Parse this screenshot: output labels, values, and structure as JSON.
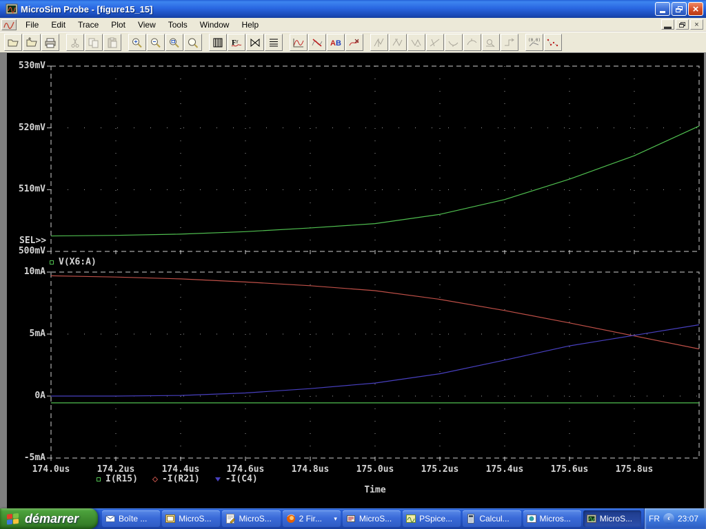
{
  "window": {
    "title": "MicroSim Probe - [figure15_15]",
    "menu": [
      "File",
      "Edit",
      "Trace",
      "Plot",
      "View",
      "Tools",
      "Window",
      "Help"
    ]
  },
  "toolbar": {
    "buttons": [
      {
        "name": "open",
        "icon": "open-icon",
        "enabled": true,
        "group": 1
      },
      {
        "name": "open-append",
        "icon": "open-append-icon",
        "enabled": true,
        "group": 1
      },
      {
        "name": "print",
        "icon": "print-icon",
        "enabled": true,
        "group": 1
      },
      {
        "name": "cut",
        "icon": "cut-icon",
        "enabled": false,
        "group": 2
      },
      {
        "name": "copy",
        "icon": "copy-icon",
        "enabled": false,
        "group": 2
      },
      {
        "name": "paste",
        "icon": "paste-icon",
        "enabled": false,
        "group": 2
      },
      {
        "name": "zoom-in",
        "icon": "zoom-in-icon",
        "enabled": true,
        "group": 3
      },
      {
        "name": "zoom-out",
        "icon": "zoom-out-icon",
        "enabled": true,
        "group": 3
      },
      {
        "name": "zoom-area",
        "icon": "zoom-area-icon",
        "enabled": true,
        "group": 3
      },
      {
        "name": "zoom-fit",
        "icon": "zoom-fit-icon",
        "enabled": true,
        "group": 3
      },
      {
        "name": "plot-columns",
        "icon": "plot-columns-icon",
        "enabled": true,
        "group": 4
      },
      {
        "name": "fourier",
        "icon": "fourier-icon",
        "enabled": true,
        "group": 4
      },
      {
        "name": "x-axis-settings",
        "icon": "x-axis-icon",
        "enabled": true,
        "group": 4
      },
      {
        "name": "y-axis-settings",
        "icon": "y-axis-icon",
        "enabled": true,
        "group": 4
      },
      {
        "name": "add-trace",
        "icon": "add-trace-icon",
        "enabled": true,
        "group": 5
      },
      {
        "name": "delete-trace",
        "icon": "delete-trace-icon",
        "enabled": true,
        "group": 5
      },
      {
        "name": "eval-goal-function",
        "icon": "eval-goal-icon",
        "enabled": true,
        "group": 5
      },
      {
        "name": "mark-trace",
        "icon": "mark-trace-icon",
        "enabled": true,
        "group": 5
      },
      {
        "name": "cursor-toggle",
        "icon": "cursor-toggle-icon",
        "enabled": false,
        "group": 6
      },
      {
        "name": "cursor-peak",
        "icon": "cursor-peak-icon",
        "enabled": false,
        "group": 6
      },
      {
        "name": "cursor-trough",
        "icon": "cursor-trough-icon",
        "enabled": false,
        "group": 6
      },
      {
        "name": "cursor-slope",
        "icon": "cursor-slope-icon",
        "enabled": false,
        "group": 6
      },
      {
        "name": "cursor-min",
        "icon": "cursor-min-icon",
        "enabled": false,
        "group": 6
      },
      {
        "name": "cursor-max",
        "icon": "cursor-max-icon",
        "enabled": false,
        "group": 6
      },
      {
        "name": "cursor-search",
        "icon": "cursor-search-icon",
        "enabled": false,
        "group": 6
      },
      {
        "name": "cursor-next",
        "icon": "cursor-next-icon",
        "enabled": false,
        "group": 6
      },
      {
        "name": "mark-point",
        "icon": "mark-point-icon",
        "enabled": true,
        "group": 7
      },
      {
        "name": "mark-data-points",
        "icon": "mark-data-points-icon",
        "enabled": true,
        "group": 7
      }
    ]
  },
  "plot": {
    "sel_label": "SEL>>"
  },
  "chart_data": [
    {
      "type": "line",
      "x": [
        174.0,
        174.2,
        174.4,
        174.6,
        174.8,
        175.0,
        175.2,
        175.4,
        175.6,
        175.8,
        176.0
      ],
      "xlim": [
        174.0,
        176.0
      ],
      "ylim": [
        500,
        530
      ],
      "y_tick_values": [
        530,
        520,
        510,
        500
      ],
      "y_tick_labels": [
        "530mV",
        "520mV",
        "510mV",
        "500mV"
      ],
      "grid": "dotted",
      "selected": true,
      "series": [
        {
          "name": "V(X6:A)",
          "color": "#50c050",
          "marker": "square",
          "values": [
            502.5,
            502.6,
            502.8,
            503.2,
            503.8,
            504.5,
            506.0,
            508.4,
            511.7,
            515.5,
            520.3
          ]
        }
      ]
    },
    {
      "type": "line",
      "x": [
        174.0,
        174.2,
        174.4,
        174.6,
        174.8,
        175.0,
        175.2,
        175.4,
        175.6,
        175.8,
        176.0
      ],
      "xlim": [
        174.0,
        176.0
      ],
      "x_tick_values": [
        174.0,
        174.2,
        174.4,
        174.6,
        174.8,
        175.0,
        175.2,
        175.4,
        175.6,
        175.8
      ],
      "x_tick_labels": [
        "174.0us",
        "174.2us",
        "174.4us",
        "174.6us",
        "174.8us",
        "175.0us",
        "175.2us",
        "175.4us",
        "175.6us",
        "175.8us"
      ],
      "xlabel": "Time",
      "ylim": [
        -5,
        10
      ],
      "y_tick_values": [
        10,
        5,
        0,
        -5
      ],
      "y_tick_labels": [
        "10mA",
        "5mA",
        "0A",
        "-5mA"
      ],
      "grid": "dotted",
      "series": [
        {
          "name": "I(R15)",
          "color": "#50c050",
          "marker": "square",
          "values": [
            -0.55,
            -0.55,
            -0.55,
            -0.55,
            -0.55,
            -0.55,
            -0.55,
            -0.55,
            -0.55,
            -0.55,
            -0.55
          ]
        },
        {
          "name": "-I(R21)",
          "color": "#c05048",
          "marker": "diamond",
          "values": [
            9.7,
            9.6,
            9.45,
            9.2,
            8.9,
            8.5,
            7.8,
            6.9,
            5.9,
            4.85,
            3.8
          ]
        },
        {
          "name": "-I(C4)",
          "color": "#4840c0",
          "marker": "triangle",
          "values": [
            0.0,
            0.0,
            0.05,
            0.25,
            0.6,
            1.05,
            1.8,
            2.9,
            4.05,
            4.9,
            5.75
          ]
        }
      ]
    }
  ],
  "taskbar": {
    "start_label": "démarrer",
    "tasks": [
      {
        "label": "Boîte ...",
        "icon": "mail-icon"
      },
      {
        "label": "MicroS...",
        "icon": "schematics-icon"
      },
      {
        "label": "MicroS...",
        "icon": "notes-icon"
      },
      {
        "label": "2 Fir...",
        "icon": "firefox-icon",
        "dropdown": true
      },
      {
        "label": "MicroS...",
        "icon": "printer2-icon"
      },
      {
        "label": "PSpice...",
        "icon": "pspice-icon"
      },
      {
        "label": "Calcul...",
        "icon": "calculator-icon"
      },
      {
        "label": "Micros...",
        "icon": "media-icon"
      },
      {
        "label": "MicroS...",
        "icon": "probe-icon",
        "active": true
      }
    ],
    "tray": {
      "language": "FR",
      "time": "23:07"
    }
  },
  "colors": {
    "trace_green": "#50c050",
    "trace_red": "#c05048",
    "trace_blue": "#4840c0",
    "axis_text": "#d4d4d4",
    "plot_bg": "#000000",
    "chrome_bg": "#ece9d8",
    "titlebar_blue": "#2a67e2",
    "taskbar_blue": "#2456c8",
    "start_green": "#3d8a2e"
  }
}
